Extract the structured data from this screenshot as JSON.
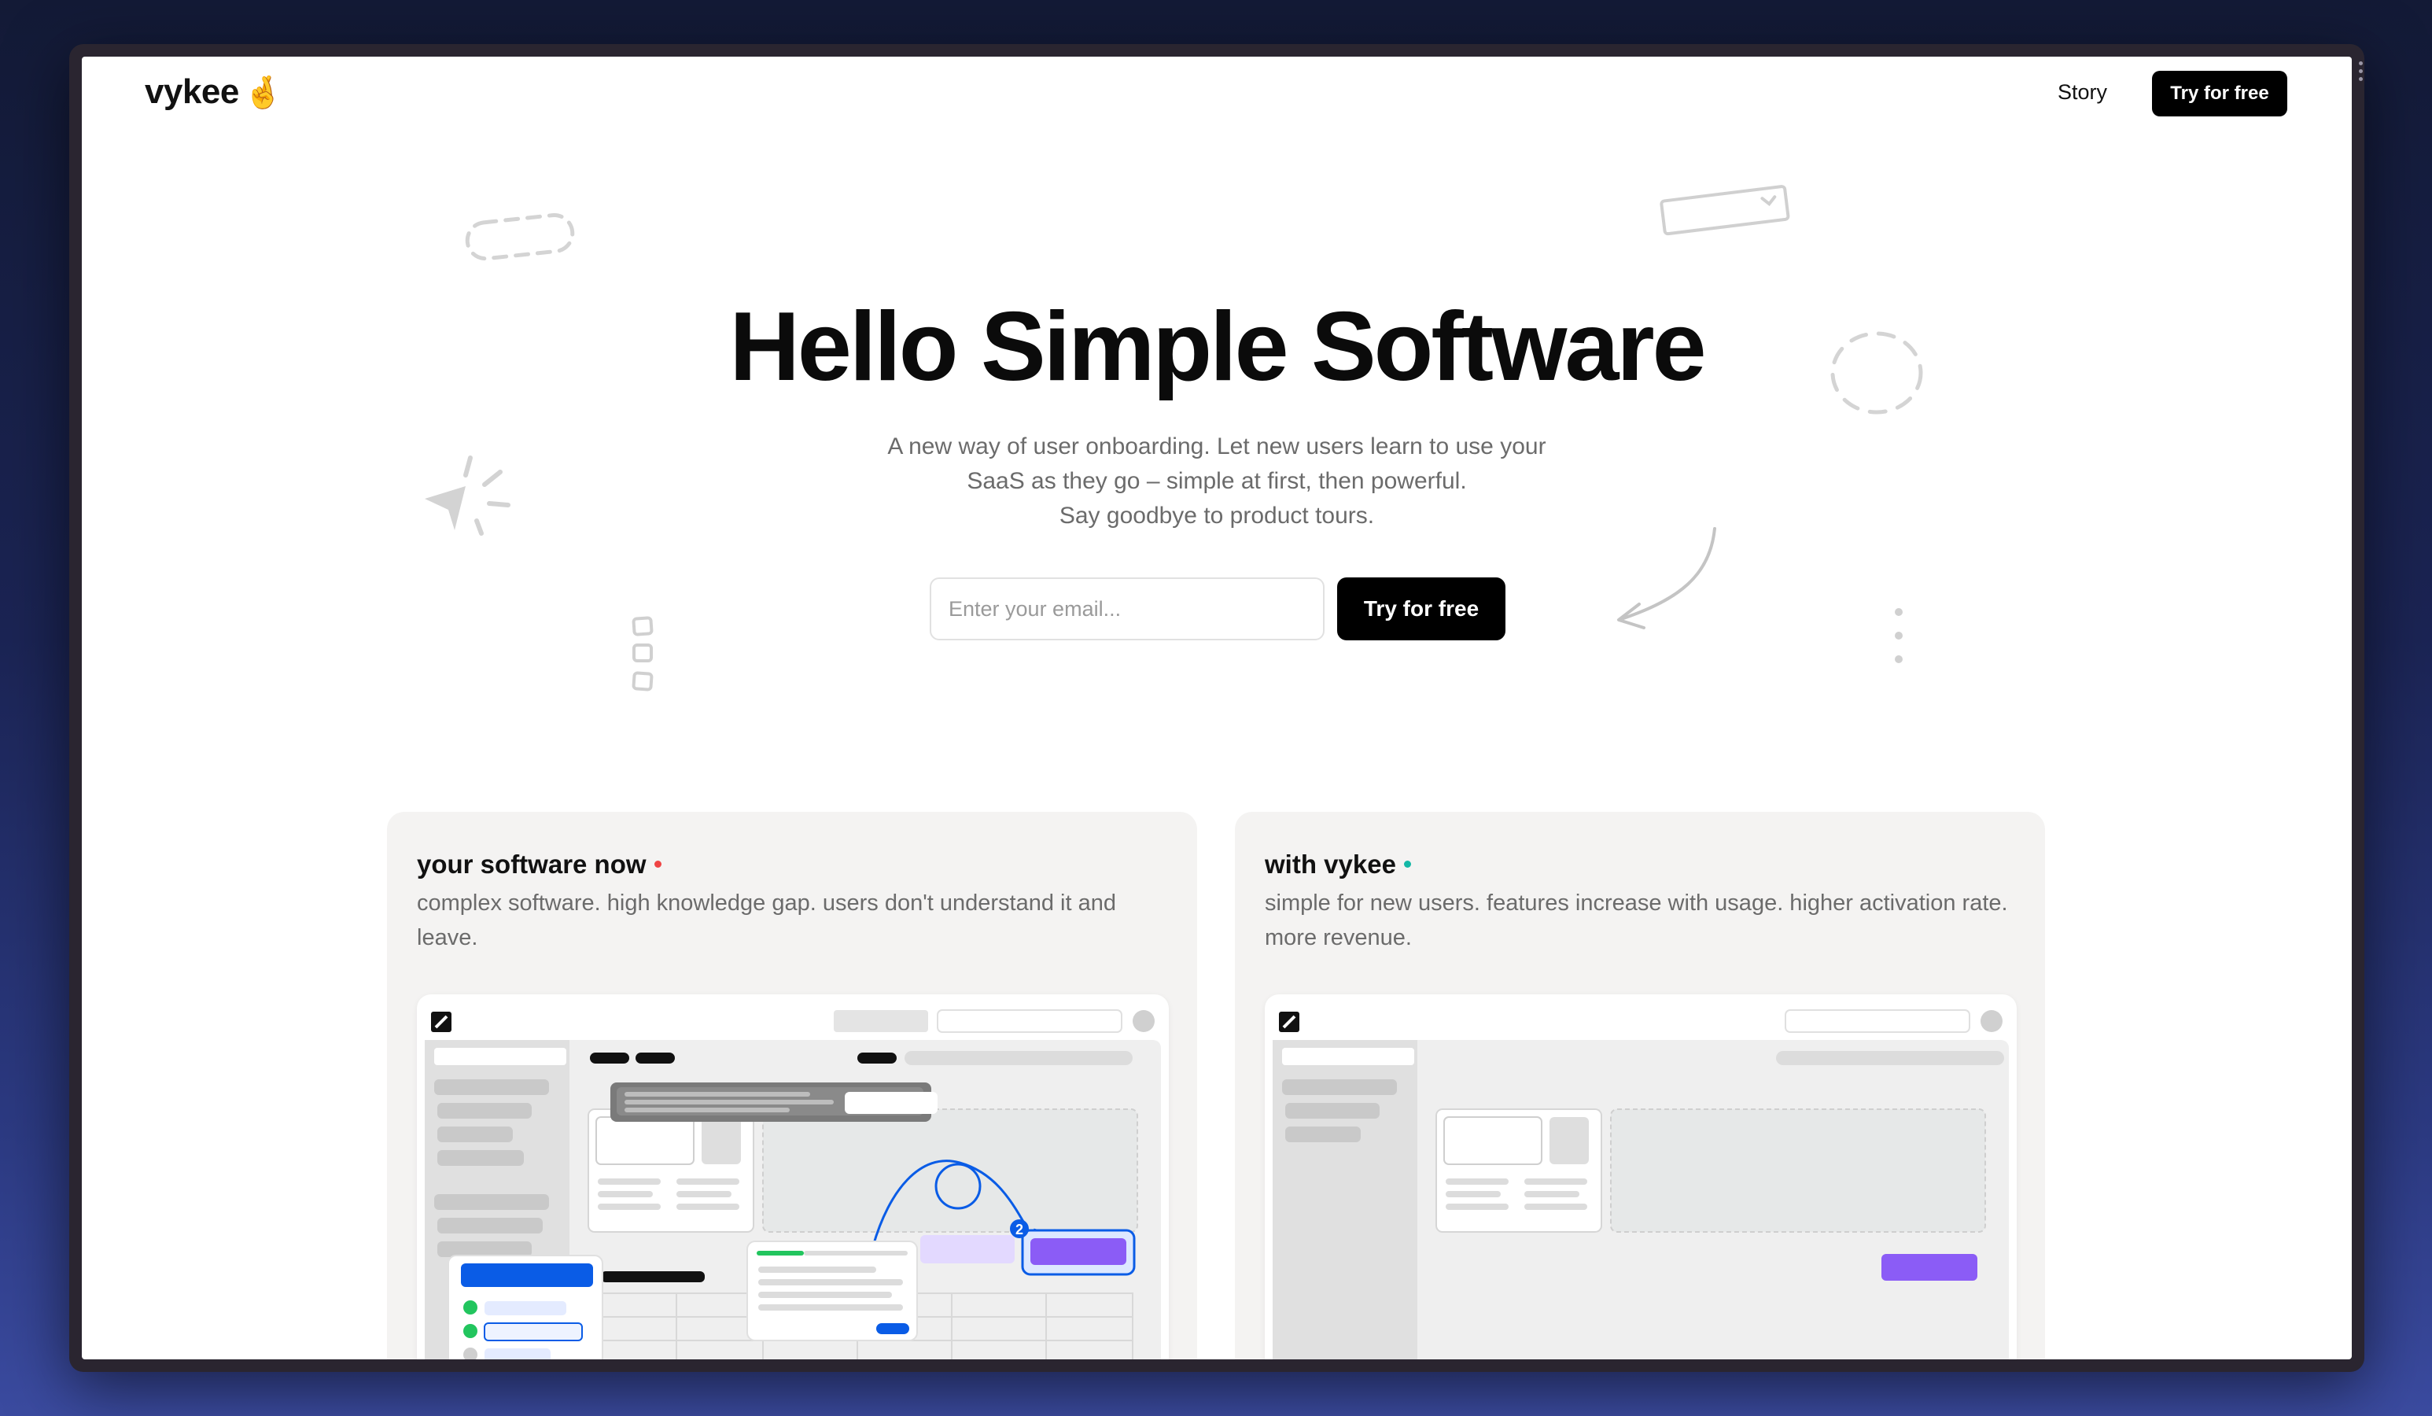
{
  "nav": {
    "logo": "vykee",
    "logo_emoji": "🤞",
    "story_link": "Story",
    "cta_label": "Try for free"
  },
  "hero": {
    "title": "Hello Simple Software",
    "subtitle_line1": "A new way of user onboarding. Let new users learn to use your",
    "subtitle_line2": "SaaS as they go – simple at first, then powerful.",
    "subtitle_line3": "Say goodbye to product tours.",
    "email_placeholder": "Enter your email...",
    "cta_label": "Try for free"
  },
  "cards": [
    {
      "title": "your software now",
      "description": "complex software. high knowledge gap. users don't understand it and leave.",
      "status_color": "#ef4444"
    },
    {
      "title": "with vykee",
      "description": "simple for new users. features increase with usage. higher activation rate. more revenue.",
      "status_color": "#14b8a6"
    }
  ],
  "mock_left": {
    "step_badge": "2"
  },
  "colors": {
    "accent_blue": "#0a5ce6",
    "accent_purple": "#8b5cf6",
    "brand_black": "#000000"
  }
}
